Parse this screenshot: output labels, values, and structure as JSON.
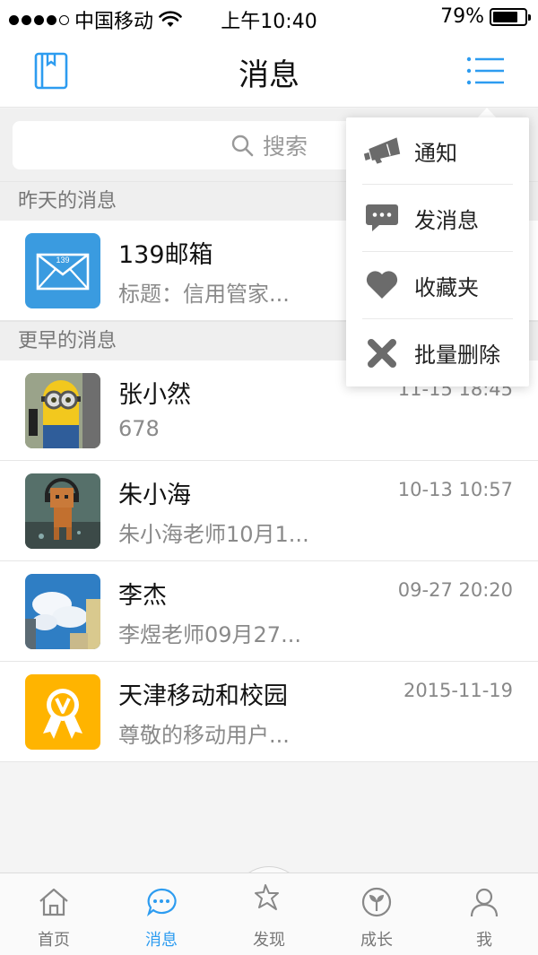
{
  "status_bar": {
    "carrier": "中国移动",
    "time": "上午10:40",
    "battery": "79%",
    "battery_level": 0.79
  },
  "nav": {
    "title": "消息"
  },
  "search": {
    "placeholder": "搜索"
  },
  "sections": {
    "yesterday": "昨天的消息",
    "earlier": "更早的消息"
  },
  "messages": [
    {
      "name": "139邮箱",
      "time": "",
      "preview": "标题：信用管家..."
    },
    {
      "name": "张小然",
      "time": "11-15 18:45",
      "preview": "678"
    },
    {
      "name": "朱小海",
      "time": "10-13 10:57",
      "preview": "朱小海老师10月1..."
    },
    {
      "name": "李杰",
      "time": "09-27 20:20",
      "preview": "李煜老师09月27..."
    },
    {
      "name": "天津移动和校园",
      "time": "2015-11-19",
      "preview": "尊敬的移动用户..."
    }
  ],
  "mail_icon_text": "139",
  "menu": [
    {
      "label": "通知",
      "icon": "megaphone-icon"
    },
    {
      "label": "发消息",
      "icon": "chat-bubble-icon"
    },
    {
      "label": "收藏夹",
      "icon": "heart-icon"
    },
    {
      "label": "批量删除",
      "icon": "x-icon"
    }
  ],
  "tabs": [
    {
      "label": "首页",
      "icon": "home-icon",
      "active": false
    },
    {
      "label": "消息",
      "icon": "message-icon",
      "active": true
    },
    {
      "label": "发现",
      "icon": "discover-icon",
      "active": false
    },
    {
      "label": "成长",
      "icon": "sprout-icon",
      "active": false
    },
    {
      "label": "我",
      "icon": "person-icon",
      "active": false
    }
  ],
  "colors": {
    "accent": "#2d9cf0",
    "mail_blue": "#3a9be0",
    "badge_orange": "#ffb400",
    "menu_icon_gray": "#6b6b6b"
  }
}
